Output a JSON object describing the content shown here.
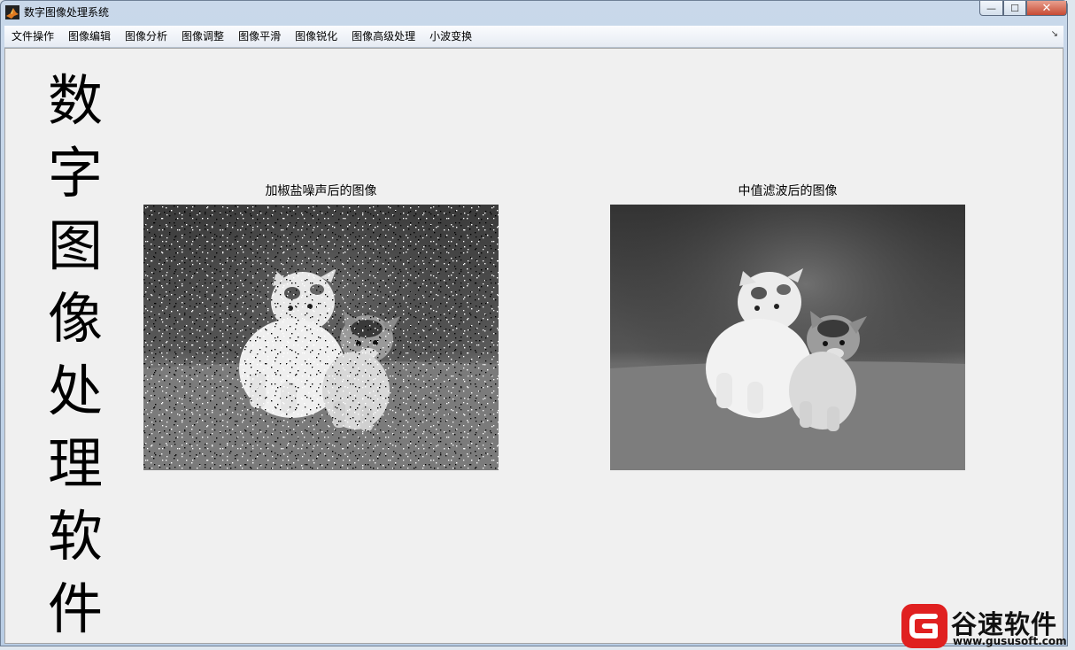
{
  "window": {
    "title": "数字图像处理系统",
    "controls": {
      "minimize": "—",
      "maximize": "☐",
      "close": "✕"
    }
  },
  "menubar": {
    "items": [
      "文件操作",
      "图像编辑",
      "图像分析",
      "图像调整",
      "图像平滑",
      "图像锐化",
      "图像高级处理",
      "小波变换"
    ],
    "overflow_icon": "↘"
  },
  "vertical_title": [
    "数",
    "字",
    "图",
    "像",
    "处",
    "理",
    "软",
    "件"
  ],
  "panels": [
    {
      "caption": "加椒盐噪声后的图像",
      "image": "grayscale kittens with salt-and-pepper noise"
    },
    {
      "caption": "中值滤波后的图像",
      "image": "grayscale kittens after median filtering"
    }
  ],
  "watermark": {
    "name": "谷速软件",
    "url": "www.gususoft.com",
    "color": "#e02020"
  },
  "colors": {
    "client_bg": "#f0f0f0",
    "frame": "#b9cde4"
  }
}
